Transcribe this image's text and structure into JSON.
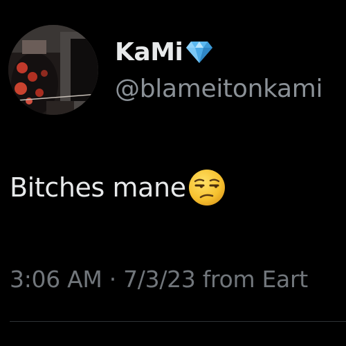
{
  "tweet": {
    "display_name": "KaMi",
    "handle": "@blameitonkami",
    "text": "Bitches mane",
    "timestamp": "3:06 AM · 7/3/23 from Eart",
    "name_badge_icon": "diamond-icon",
    "text_emoji_icon": "unamused-face-icon"
  },
  "colors": {
    "background": "#000000",
    "primary_text": "#e7e9ea",
    "secondary_text": "#71767b",
    "divider": "#2f3336",
    "diamond": "#5ab8f0",
    "emoji": "#f6c12f"
  }
}
